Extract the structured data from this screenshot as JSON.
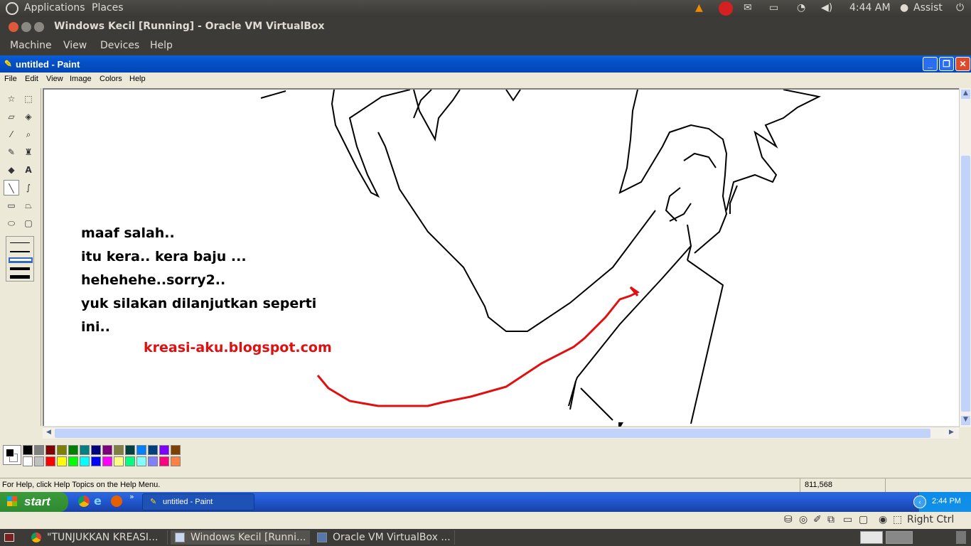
{
  "top_panel": {
    "applications": "Applications",
    "places": "Places",
    "clock": "4:44 AM",
    "user": "Assist"
  },
  "vbox": {
    "title": "Windows Kecil [Running] - Oracle VM VirtualBox",
    "menu": [
      "Machine",
      "View",
      "Devices",
      "Help"
    ],
    "host_key": "Right Ctrl"
  },
  "paint": {
    "title": "untitled - Paint",
    "menu": [
      "File",
      "Edit",
      "View",
      "Image",
      "Colors",
      "Help"
    ],
    "canvas_text": [
      "maaf salah..",
      "itu kera.. kera baju ...",
      "hehehehe..sorry2..",
      "yuk silakan dilanjutkan seperti",
      "ini.."
    ],
    "blog": "kreasi-aku.blogspot.com",
    "blog_color": "#e01010",
    "status_help": "For Help, click Help Topics on the Help Menu.",
    "coords": "811,568",
    "palette_top": [
      "#000000",
      "#808080",
      "#800000",
      "#808000",
      "#008000",
      "#008080",
      "#000080",
      "#800080",
      "#808040",
      "#004040",
      "#0080ff",
      "#004080",
      "#8000ff",
      "#804000"
    ],
    "palette_bottom": [
      "#ffffff",
      "#c0c0c0",
      "#ff0000",
      "#ffff00",
      "#00ff00",
      "#00ffff",
      "#0000ff",
      "#ff00ff",
      "#ffff80",
      "#00ff80",
      "#80ffff",
      "#8080ff",
      "#ff0080",
      "#ff8040"
    ]
  },
  "xp_taskbar": {
    "start": "start",
    "task": "untitled - Paint",
    "clock": "2:44 PM"
  },
  "bottom_panel": {
    "tasks": [
      "\"TUNJUKKAN KREASI...",
      "Windows Kecil [Runni...",
      "Oracle VM VirtualBox ..."
    ]
  }
}
